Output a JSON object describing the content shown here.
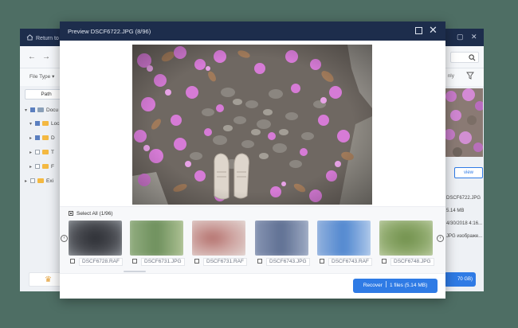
{
  "background_app": {
    "title": "Return to",
    "toolbar": {
      "back": "←",
      "forward": "→"
    },
    "filter": {
      "file_type": "File Type",
      "only_label": "nly"
    },
    "path_tab": "Path",
    "tree": [
      {
        "label": "Docu",
        "arrow": "▾",
        "state": "partial"
      },
      {
        "label": "Loc",
        "arrow": "▾",
        "state": "partial"
      },
      {
        "label": "D",
        "arrow": "▸",
        "state": "checked"
      },
      {
        "label": "T",
        "arrow": "▸",
        "state": "empty"
      },
      {
        "label": "F",
        "arrow": "▸",
        "state": "empty"
      },
      {
        "label": "Exi",
        "arrow": "▸",
        "state": "empty"
      }
    ],
    "right_panel": {
      "button": "view",
      "info": [
        "DSCF6722.JPG",
        "5.14 MB",
        "4/30/2018 4:16...",
        "JPG изображе..."
      ]
    },
    "bottom_button": "70 GB)"
  },
  "dialog": {
    "title": "Preview DSCF6722.JPG (8/96)",
    "select_all": "Select All (1/96)",
    "thumbnails": [
      {
        "name": "DSCF6728.RAF",
        "checked": false
      },
      {
        "name": "DSCF6731.JPG",
        "checked": false
      },
      {
        "name": "DSCF6731.RAF",
        "checked": false
      },
      {
        "name": "DSCF6743.JPG",
        "checked": false
      },
      {
        "name": "DSCF6743.RAF",
        "checked": false
      },
      {
        "name": "DSCF6748.JPG",
        "checked": false
      }
    ],
    "recover_button": {
      "label": "Recover",
      "detail": "1 files (5.14 MB)"
    }
  },
  "colors": {
    "desktop": "#4e6e64",
    "titlebar": "#1d2d4c",
    "accent": "#2f7be5"
  },
  "icons": [
    "home-icon",
    "back-arrow-icon",
    "forward-arrow-icon",
    "search-icon",
    "filter-icon",
    "crown-icon",
    "maximize-icon",
    "close-icon",
    "chevron-left-icon",
    "chevron-right-icon"
  ]
}
